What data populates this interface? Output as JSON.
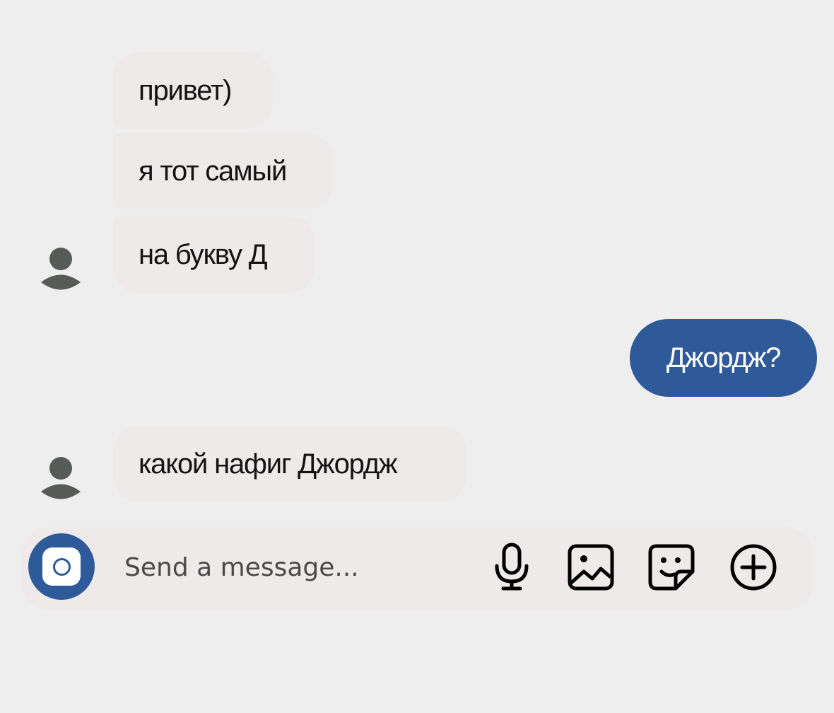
{
  "conversation": {
    "messages": [
      {
        "direction": "incoming",
        "text": "привет)"
      },
      {
        "direction": "incoming",
        "text": "я тот самый"
      },
      {
        "direction": "incoming",
        "text": "на букву Д"
      },
      {
        "direction": "outgoing",
        "text": "Джордж?"
      },
      {
        "direction": "incoming",
        "text": "какой нафиг Джордж"
      }
    ]
  },
  "composer": {
    "placeholder": "Send a message...",
    "icons": [
      "camera-icon",
      "microphone-icon",
      "image-icon",
      "sticker-icon",
      "plus-circle-icon"
    ]
  },
  "colors": {
    "background": "#efeeee",
    "incoming_bubble": "#eeeaea",
    "outgoing_bubble": "#2f5a9a",
    "accent": "#2f5a9a",
    "avatar": "#575b58"
  }
}
